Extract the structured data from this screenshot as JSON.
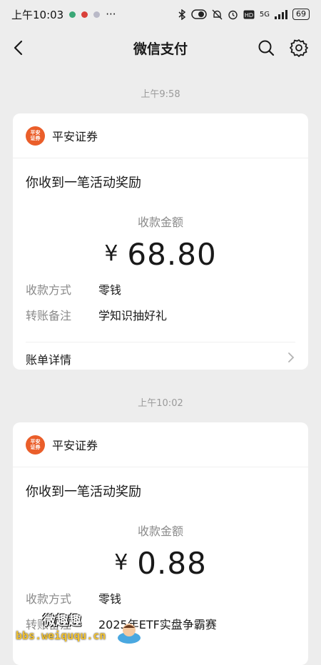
{
  "status_bar": {
    "time": "上午10:03",
    "dots": "···",
    "network": "5G",
    "battery": "69",
    "colors": {
      "app1": "#3aa776",
      "app2": "#d9403a",
      "app3": "#b9b9c7"
    }
  },
  "nav": {
    "title": "微信支付",
    "back_icon": "chevron-left",
    "search_icon": "search",
    "settings_icon": "gear"
  },
  "messages": [
    {
      "time": "上午9:58",
      "merchant": "平安证券",
      "logo_text": "平安\n证券",
      "title": "你收到一笔活动奖励",
      "amount_label": "收款金额",
      "currency": "¥",
      "amount": "68.80",
      "rows": [
        {
          "key": "收款方式",
          "value": "零钱"
        },
        {
          "key": "转账备注",
          "value": "学知识抽好礼"
        }
      ],
      "footer": "账单详情"
    },
    {
      "time": "上午10:02",
      "merchant": "平安证券",
      "logo_text": "平安\n证券",
      "title": "你收到一笔活动奖励",
      "amount_label": "收款金额",
      "currency": "¥",
      "amount": "0.88",
      "rows": [
        {
          "key": "收款方式",
          "value": "零钱"
        },
        {
          "key": "转账备注",
          "value": "2025年ETF实盘争霸赛"
        }
      ]
    }
  ],
  "watermark": {
    "text1": "微趣趣",
    "text2": "bbs.weiququ.cn"
  },
  "brand_color": "#ea5e2a"
}
